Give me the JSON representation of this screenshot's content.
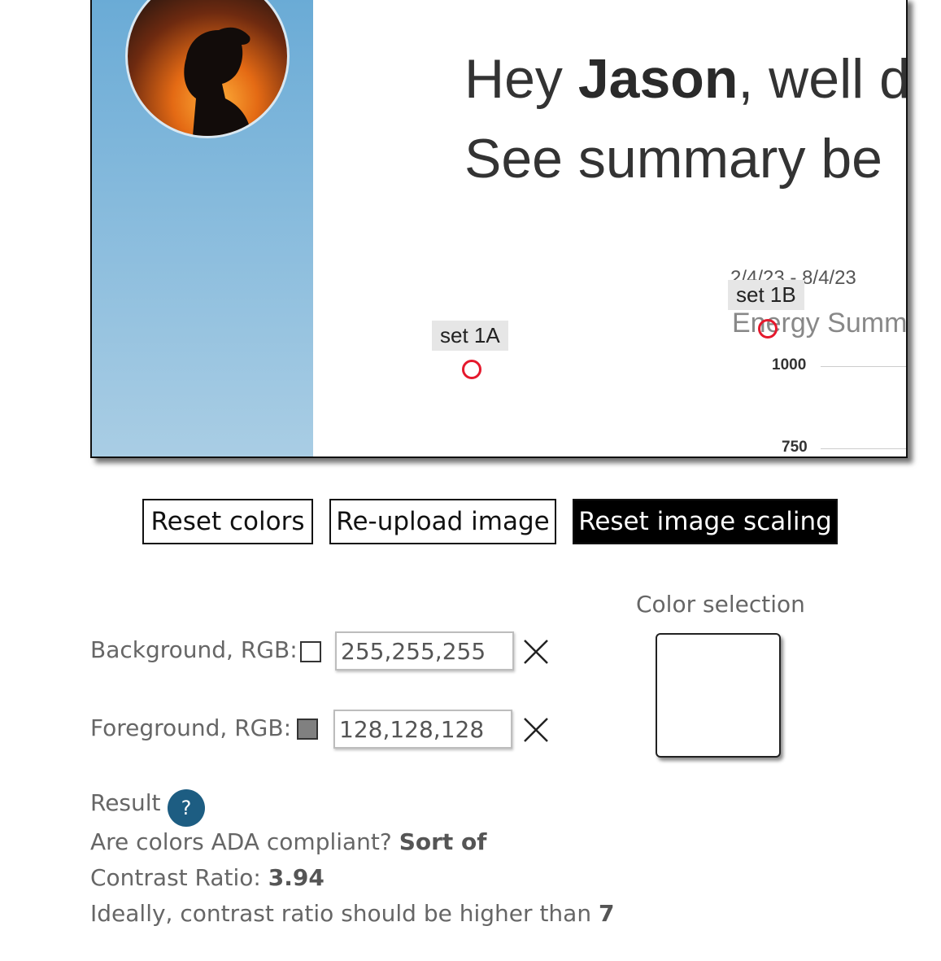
{
  "preview": {
    "greeting_prefix": "Hey ",
    "greeting_name": "Jason",
    "greeting_suffix": ", well d",
    "summary_line": "See summary be",
    "marker_1a": "set 1A",
    "marker_1b": "set 1B",
    "date_range": "2/4/23 - 8/4/23",
    "chart_title": "Energy Summ",
    "tick_1000": "1000",
    "tick_750": "750"
  },
  "buttons": {
    "reset_colors": "Reset colors",
    "reupload": "Re-upload image",
    "reset_scaling": "Reset image scaling"
  },
  "background": {
    "label": "Background, RGB:",
    "value": "255,255,255",
    "swatch_color": "#ffffff"
  },
  "foreground": {
    "label": "Foreground, RGB:",
    "value": "128,128,128",
    "swatch_color": "#808080"
  },
  "color_selection": {
    "label": "Color selection",
    "color": "#ffffff"
  },
  "result": {
    "label": "Result",
    "help_icon": "?",
    "ada_question": "Are colors ADA compliant?",
    "ada_answer": "Sort of",
    "contrast_label": "Contrast Ratio:",
    "contrast_value": "3.94",
    "ideal_text": "Ideally, contrast ratio should be higher than",
    "ideal_value": "7"
  },
  "icons": {
    "clear": "close-icon",
    "help": "help-icon",
    "marker": "circle-marker-icon"
  }
}
